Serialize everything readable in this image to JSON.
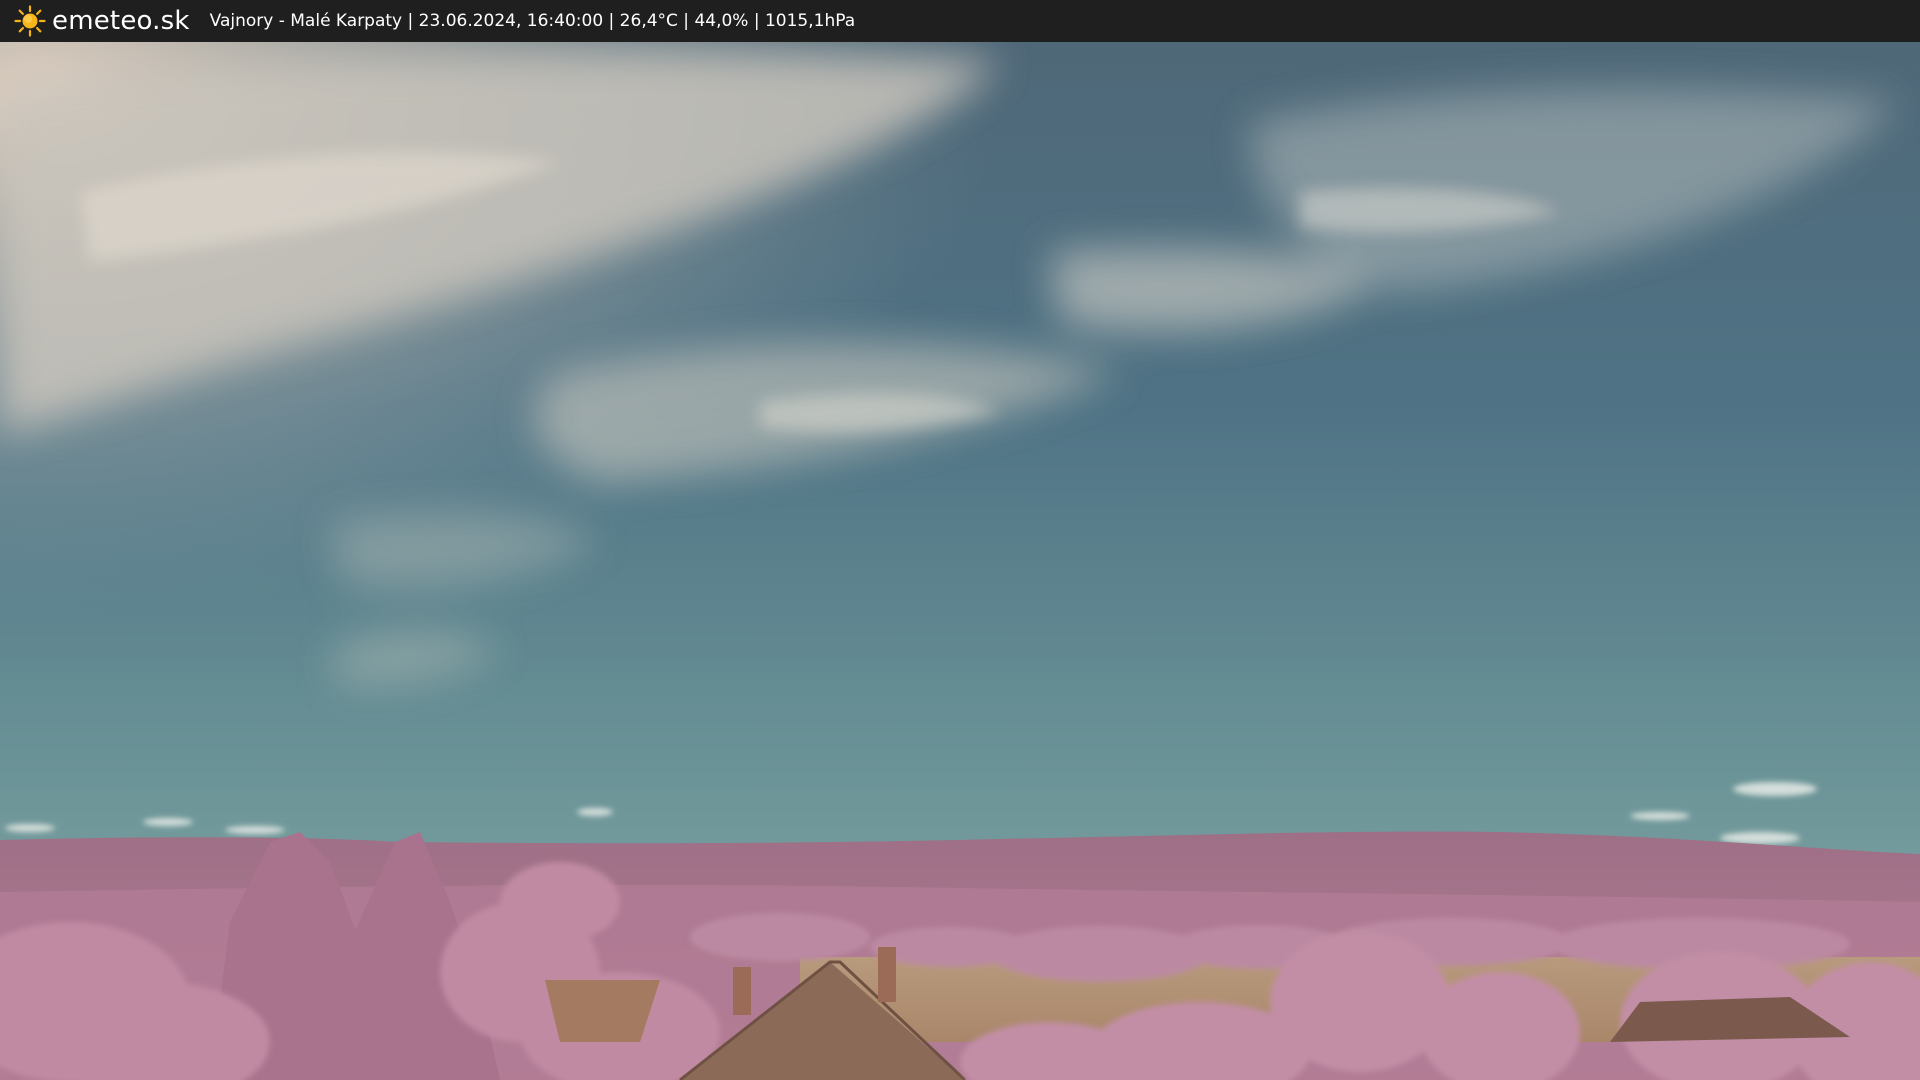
{
  "header": {
    "brand": "emeteo.sk",
    "info": "Vajnory - Malé Karpaty | 23.06.2024, 16:40:00 | 26,4°C | 44,0% | 1015,1hPa",
    "logo_icon": "sun-icon"
  },
  "colors": {
    "bar_bg": "#1f1f1f",
    "sun": "#f5b31a",
    "sky_top": "#3f5c6e",
    "sky_bottom": "#86a9a6",
    "foliage": "#b9819b",
    "field": "#b89878",
    "roof": "#8d6a57"
  }
}
